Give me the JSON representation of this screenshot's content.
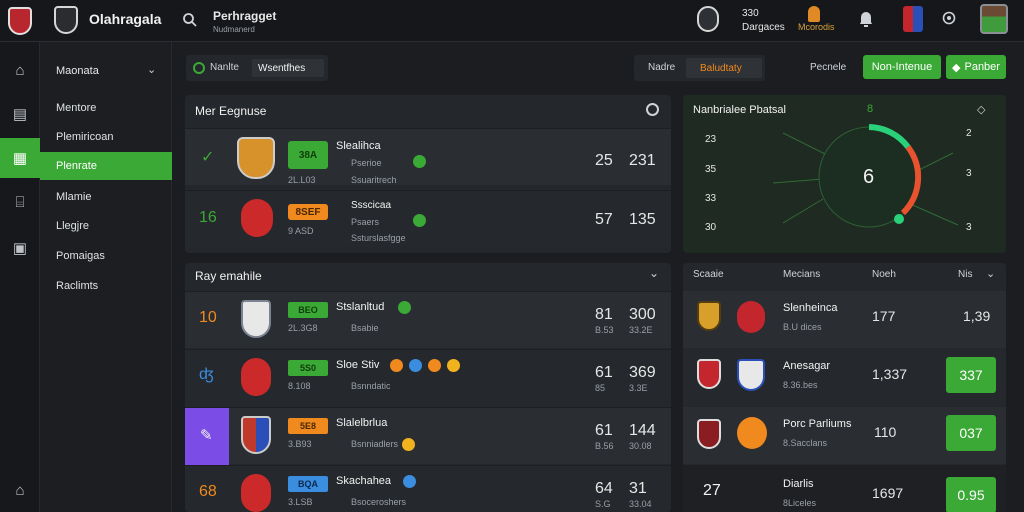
{
  "app": {
    "name": "Olahragala",
    "subtitle_title": "Perhragget",
    "subtitle_sub": "Nudmanerd"
  },
  "header": {
    "status_label_top": "330",
    "status_label_bottom": "Dargaces",
    "muted_label": "Mcorodis"
  },
  "colors": {
    "accent": "#3ba936",
    "orange": "#f08a1e",
    "blue": "#3b8de0",
    "purple": "#7b4ce6"
  },
  "sidebar": {
    "group_label": "Maonata",
    "items": [
      {
        "label": "Mentore"
      },
      {
        "label": "Plemiricoan"
      },
      {
        "label": "Plenrate"
      },
      {
        "label": "Mlamie"
      },
      {
        "label": "Llegjre"
      },
      {
        "label": "Pomaigas"
      },
      {
        "label": "Raclimts"
      }
    ]
  },
  "toolbar": {
    "filter_label": "Nanlte",
    "filter_value": "Wsentfhes",
    "mode_label": "Nadre",
    "mode_value": "Baludtaty",
    "status_label": "Pecnele",
    "primary_button": "Non-Intenue",
    "secondary_button": "Panber"
  },
  "live_panel": {
    "title": "Mer Eegnuse",
    "rows": [
      {
        "badge": "38A",
        "sub": "2L.L03",
        "name": "Slealihca",
        "detail1": "Pserioe",
        "detail2": "Ssuaritrech",
        "score_a": "25",
        "score_b": "231",
        "lead": ""
      },
      {
        "badge": "8SEF",
        "sub": "9 ASD",
        "name": "Ssscicaa",
        "detail1": "Psaers",
        "detail2": "Ssturslasfgge",
        "score_a": "57",
        "score_b": "135",
        "lead": "16"
      }
    ]
  },
  "gauge_panel": {
    "title": "Nanbrialee Pbatsal",
    "value": "6",
    "top_marker": "8",
    "axis_left": [
      "23",
      "35",
      "33",
      "30"
    ],
    "axis_right": [
      "2",
      "3",
      "3"
    ]
  },
  "play_panel": {
    "title": "Ray emahile",
    "rows": [
      {
        "lead": "10",
        "badge": "BEO",
        "sub": "2L.3G8",
        "name": "Stslanltud",
        "detail": "Bsabie",
        "score_a": "81",
        "score_b": "300",
        "score_sub_a": "B.53",
        "score_sub_b": "33.2E"
      },
      {
        "lead": "",
        "badge": "5S0",
        "sub": "8.108",
        "name": "Sloe Stiv",
        "detail": "Bsnndatic",
        "score_a": "61",
        "score_b": "369",
        "score_sub_a": "85",
        "score_sub_b": "3.3E"
      },
      {
        "lead": "",
        "badge": "5E8",
        "sub": "3.B93",
        "name": "Slalelbrlua",
        "detail": "Bsnniadlers",
        "score_a": "61",
        "score_b": "144",
        "score_sub_a": "B.56",
        "score_sub_b": "30.08"
      },
      {
        "lead": "68",
        "badge": "BQA",
        "sub": "3.LSB",
        "name": "Skachahea",
        "detail": "Bsoceroshers",
        "score_a": "64",
        "score_b": "31",
        "score_sub_a": "S.G",
        "score_sub_b": "33.04"
      }
    ]
  },
  "stats_panel": {
    "headers": [
      "Scaaie",
      "Mecians",
      "Noeh",
      "Nis"
    ],
    "rows": [
      {
        "name": "Slenheinca",
        "sub": "B.U dices",
        "value": "177",
        "odds": "1,39",
        "highlight": false
      },
      {
        "name": "Anesagar",
        "sub": "8.36.bes",
        "value": "1,337",
        "odds": "337",
        "highlight": true
      },
      {
        "name": "Porc Parliums",
        "sub": "8.Sacclans",
        "value": "110",
        "odds": "037",
        "highlight": true
      },
      {
        "name": "Diarlis",
        "sub": "8Liceles",
        "value": "1697",
        "odds": "0.95",
        "highlight": true,
        "lead": "27"
      }
    ]
  }
}
